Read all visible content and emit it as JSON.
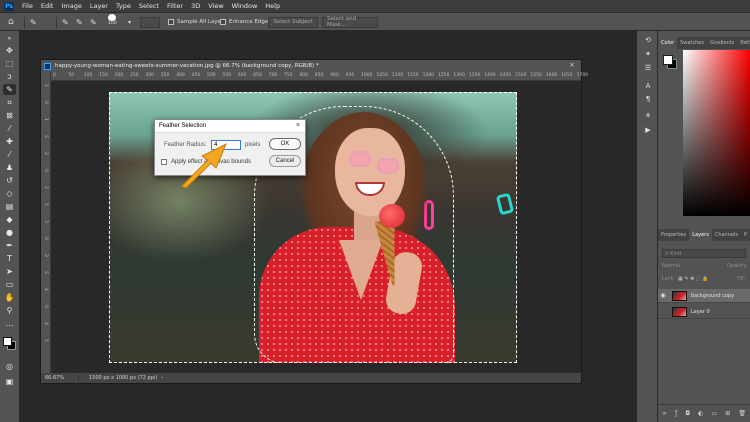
{
  "menu": {
    "logo": "Ps",
    "items": [
      "File",
      "Edit",
      "Image",
      "Layer",
      "Type",
      "Select",
      "Filter",
      "3D",
      "View",
      "Window",
      "Help"
    ]
  },
  "options": {
    "brush_size": "100",
    "sample_all_layers": "Sample All Layers",
    "enhance_edge": "Enhance Edge",
    "select_subject": "Select Subject",
    "select_and_mask": "Select and Mask..."
  },
  "document": {
    "tab_title": "happy-young-woman-eating-sweets-summer-vacation.jpg @ 66.7% (background copy, RGB/8) *",
    "zoom": "66.67%",
    "dimensions": "1500 px x 1000 px (72 ppi)",
    "ruler_top": [
      "0",
      "50",
      "100",
      "150",
      "200",
      "250",
      "300",
      "350",
      "400",
      "450",
      "500",
      "550",
      "600",
      "650",
      "700",
      "750",
      "800",
      "850",
      "900",
      "950",
      "1000",
      "1050",
      "1100",
      "1150",
      "1200",
      "1250",
      "1300",
      "1350",
      "1400",
      "1450",
      "1500",
      "1550",
      "1600",
      "1650",
      "1700"
    ],
    "ruler_left": [
      "1",
      "0",
      "1",
      "5",
      "2",
      "0",
      "2",
      "5",
      "3",
      "0",
      "3",
      "5",
      "4",
      "0",
      "4",
      "5"
    ]
  },
  "dialog": {
    "title": "Feather Selection",
    "radius_label": "Feather Radius:",
    "radius_value": "4",
    "unit": "pixels",
    "ok": "OK",
    "cancel": "Cancel",
    "apply_label": "Apply effect at canvas bounds",
    "arrow_color": "#f5a623"
  },
  "panels": {
    "color_tabs": [
      "Color",
      "Swatches",
      "Gradients",
      "Patt"
    ],
    "layer_tabs": [
      "Properties",
      "Layers",
      "Channels",
      "P"
    ],
    "search_placeholder": "Kind",
    "blend_mode": "Normal",
    "opacity_label": "Opacity:",
    "lock_label": "Lock:",
    "fill_label": "Fill:",
    "layers": [
      {
        "name": "background copy",
        "selected": true
      },
      {
        "name": "Layer 0",
        "selected": false
      }
    ],
    "bottom_icons": [
      "link-icon",
      "fx-icon",
      "mask-icon",
      "adjustment-icon",
      "group-icon",
      "new-layer-icon",
      "trash-icon"
    ]
  },
  "colors": {
    "accent": "#31a8ff",
    "dress": "#d9202a"
  }
}
